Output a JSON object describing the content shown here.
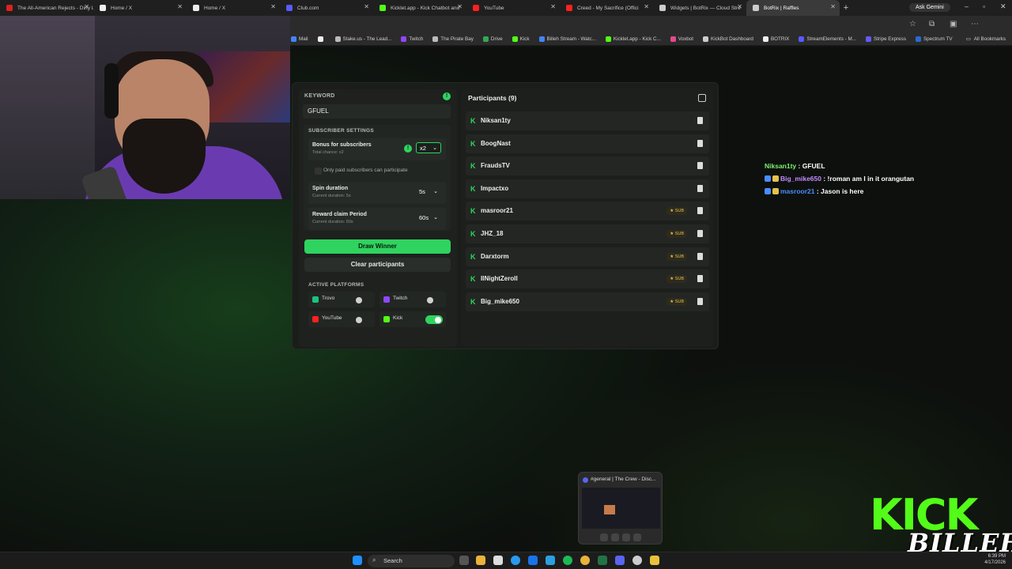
{
  "browser": {
    "tabs": [
      {
        "title": "The All-American Rejects - Dirty Little Secret",
        "fav": "#e02020",
        "active": false
      },
      {
        "title": "Home / X",
        "fav": "#eeeeee",
        "active": false
      },
      {
        "title": "Home / X",
        "fav": "#eeeeee",
        "active": false
      },
      {
        "title": "Club.com",
        "fav": "#5a5aff",
        "active": false
      },
      {
        "title": "Kicklet.app - Kick Chatbot and",
        "fav": "#53fc18",
        "active": false
      },
      {
        "title": "YouTube",
        "fav": "#ff2020",
        "active": false
      },
      {
        "title": "Creed - My Sacrifice (Offici",
        "fav": "#ff2020",
        "active": false
      },
      {
        "title": "Widgets | BotRix — Cloud Stre",
        "fav": "#cccccc",
        "active": false
      },
      {
        "title": "BotRix | Raffles",
        "fav": "#cccccc",
        "active": true
      }
    ],
    "new_tab": "+",
    "ask_gemini": "Ask Gemini",
    "bookmarks": [
      {
        "label": "Mail",
        "color": "#4285f4"
      },
      {
        "label": "",
        "color": "#eeeeee"
      },
      {
        "label": "Stake.us - The Lead...",
        "color": "#bbbbbb"
      },
      {
        "label": "Twitch",
        "color": "#9146ff"
      },
      {
        "label": "The Pirate Bay",
        "color": "#bbbbbb"
      },
      {
        "label": "Drive",
        "color": "#34a853"
      },
      {
        "label": "Kick",
        "color": "#53fc18"
      },
      {
        "label": "Billeh Stream - Watc...",
        "color": "#4285f4"
      },
      {
        "label": "Kicklet.app - Kick C...",
        "color": "#53fc18"
      },
      {
        "label": "Voxbot",
        "color": "#e54a8a"
      },
      {
        "label": "KickBot Dashboard",
        "color": "#cccccc"
      },
      {
        "label": "BOTRIX",
        "color": "#eeeeee"
      },
      {
        "label": "StreamElements - M...",
        "color": "#5a5aff"
      },
      {
        "label": "Stripe Express",
        "color": "#635bff"
      },
      {
        "label": "Spectrum TV",
        "color": "#2a6ad0"
      }
    ],
    "all_bookmarks": "All Bookmarks"
  },
  "raffle": {
    "keyword_label": "KEYWORD",
    "keyword_value": "GFUEL",
    "subscriber_settings_label": "SUBSCRIBER SETTINGS",
    "bonus": {
      "title": "Bonus for subscribers",
      "sub": "Total chance: x2",
      "value": "x2"
    },
    "paid_only": "Only paid subscribers can participate",
    "spin": {
      "title": "Spin duration",
      "sub": "Current duration: 5s",
      "value": "5s"
    },
    "reward": {
      "title": "Reward claim Period",
      "sub": "Current duration: 60s",
      "value": "60s"
    },
    "draw_button": "Draw Winner",
    "clear_button": "Clear participants",
    "platforms_label": "ACTIVE PLATFORMS",
    "platforms": [
      {
        "name": "Trovo",
        "color": "#1bc47d",
        "enabled": false
      },
      {
        "name": "Twitch",
        "color": "#9146ff",
        "enabled": false
      },
      {
        "name": "YouTube",
        "color": "#ff2020",
        "enabled": false
      },
      {
        "name": "Kick",
        "color": "#53fc18",
        "enabled": true
      }
    ],
    "accent": "#2fd35f"
  },
  "participants": {
    "title": "Participants (9)",
    "sub_label": "SUB",
    "list": [
      {
        "name": "Niksan1ty",
        "sub": false
      },
      {
        "name": "BoogNast",
        "sub": false
      },
      {
        "name": "FraudsTV",
        "sub": false
      },
      {
        "name": "Impactxo",
        "sub": false
      },
      {
        "name": "masroor21",
        "sub": true
      },
      {
        "name": "JHZ_18",
        "sub": true
      },
      {
        "name": "Darxtorm",
        "sub": true
      },
      {
        "name": "IINightZeroII",
        "sub": true
      },
      {
        "name": "Big_mike650",
        "sub": true
      }
    ]
  },
  "chat": [
    {
      "user": "Niksan1ty",
      "message": ": GFUEL",
      "color": "#7cf26b"
    },
    {
      "user": "Big_mike650",
      "message": ": !roman am I in it orangutan",
      "color": "#c08cff"
    },
    {
      "user": "masroor21",
      "message": ": Jason is here",
      "color": "#4a8cff"
    }
  ],
  "popup": {
    "title": "#general | The Crew - Disc..."
  },
  "overlay": {
    "kick": "KICK",
    "billeh": "BILLEH"
  },
  "taskbar": {
    "search": "Search",
    "time": "6:39 PM",
    "date": "4/17/2026"
  }
}
